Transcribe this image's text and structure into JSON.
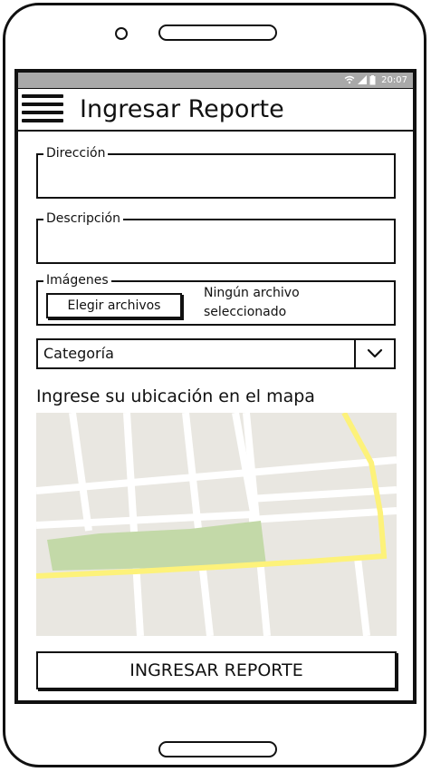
{
  "status_bar": {
    "time": "20:07",
    "icons": [
      "wifi-icon",
      "signal-icon",
      "battery-icon"
    ]
  },
  "app_bar": {
    "title": "Ingresar Reporte",
    "menu_icon": "hamburger-menu-icon"
  },
  "form": {
    "direccion": {
      "label": "Dirección",
      "value": ""
    },
    "descripcion": {
      "label": "Descripción",
      "value": ""
    },
    "imagenes": {
      "label": "Imágenes",
      "button_label": "Elegir archivos",
      "status_text": "Ningún archivo seleccionado"
    },
    "categoria": {
      "selected": "Categoría",
      "arrow_icon": "chevron-down-icon"
    },
    "map_label": "Ingrese su ubicación en el mapa",
    "submit_label": "INGRESAR REPORTE"
  },
  "map": {
    "colors": {
      "land": "#e9e7e1",
      "road": "#ffffff",
      "highway": "#fdf27a",
      "park": "#c3d9a8"
    }
  }
}
